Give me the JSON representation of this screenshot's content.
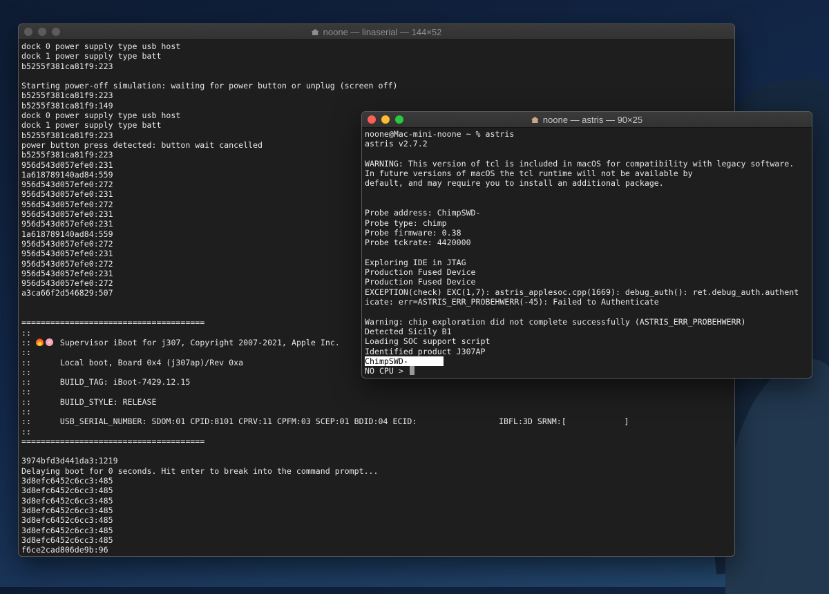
{
  "background": {
    "accent": "#13284a"
  },
  "window_back": {
    "title": "noone — linaserial — 144×52",
    "lines": [
      "dock 0 power supply type usb host",
      "dock 1 power supply type batt",
      "b5255f381ca81f9:223",
      "",
      "Starting power-off simulation: waiting for power button or unplug (screen off)",
      "b5255f381ca81f9:223",
      "b5255f381ca81f9:149",
      "dock 0 power supply type usb host",
      "dock 1 power supply type batt",
      "b5255f381ca81f9:223",
      "power button press detected: button wait cancelled",
      "b5255f381ca81f9:223",
      "956d543d057efe0:231",
      "1a618789140ad84:559",
      "956d543d057efe0:272",
      "956d543d057efe0:231",
      "956d543d057efe0:272",
      "956d543d057efe0:231",
      "956d543d057efe0:231",
      "1a618789140ad84:559",
      "956d543d057efe0:272",
      "956d543d057efe0:231",
      "956d543d057efe0:272",
      "956d543d057efe0:231",
      "956d543d057efe0:272",
      "a3ca66f2d546829:507",
      "",
      "",
      "======================================",
      "::",
      "__EMOJI__",
      "::",
      "::      Local boot, Board 0x4 (j307ap)/Rev 0xa",
      "::",
      "::      BUILD_TAG: iBoot-7429.12.15",
      "::",
      "::      BUILD_STYLE: RELEASE",
      "::",
      "::      USB_SERIAL_NUMBER: SDOM:01 CPID:8101 CPRV:11 CPFM:03 SCEP:01 BDID:04 ECID:                 IBFL:3D SRNM:[            ]",
      "::",
      "======================================",
      "",
      "3974bfd3d441da3:1219",
      "Delaying boot for 0 seconds. Hit enter to break into the command prompt...",
      "3d8efc6452c6cc3:485",
      "3d8efc6452c6cc3:485",
      "3d8efc6452c6cc3:485",
      "3d8efc6452c6cc3:485",
      "3d8efc6452c6cc3:485",
      "3d8efc6452c6cc3:485",
      "3d8efc6452c6cc3:485",
      "f6ce2cad806de9b:96"
    ],
    "supervisor_prefix": ":: ",
    "supervisor_text": "Supervisor iBoot for j307, Copyright 2007-2021, Apple Inc.",
    "emoji_icons": [
      "fire-icon",
      "flower-icon"
    ]
  },
  "window_front": {
    "title": "noone — astris — 90×25",
    "lines": [
      "noone@Mac-mini-noone ~ % astris",
      "astris v2.7.2",
      "",
      "WARNING: This version of tcl is included in macOS for compatibility with legacy software.",
      "In future versions of macOS the tcl runtime will not be available by",
      "default, and may require you to install an additional package.",
      "",
      "",
      "Probe address: ChimpSWD-",
      "Probe type: chimp",
      "Probe firmware: 0.38",
      "Probe tckrate: 4420000",
      "",
      "Exploring IDE in JTAG",
      "Production Fused Device",
      "Production Fused Device",
      "EXCEPTION(check) EXC(1,7): astris_applesoc.cpp(1669): debug_auth(): ret.debug_auth.authent",
      "icate: err=ASTRIS_ERR_PROBEHWERR(-45): Failed to Authenticate",
      "",
      "Warning: chip exploration did not complete successfully (ASTRIS_ERR_PROBEHWERR)",
      "Detected Sicily B1",
      "Loading SOC support script",
      "Identified product J307AP"
    ],
    "selected_line": "ChimpSWD-",
    "prompt": "NO CPU > ",
    "traffic_lights": {
      "close": "#ff5f57",
      "minimize": "#febc2e",
      "zoom": "#28c840"
    }
  }
}
